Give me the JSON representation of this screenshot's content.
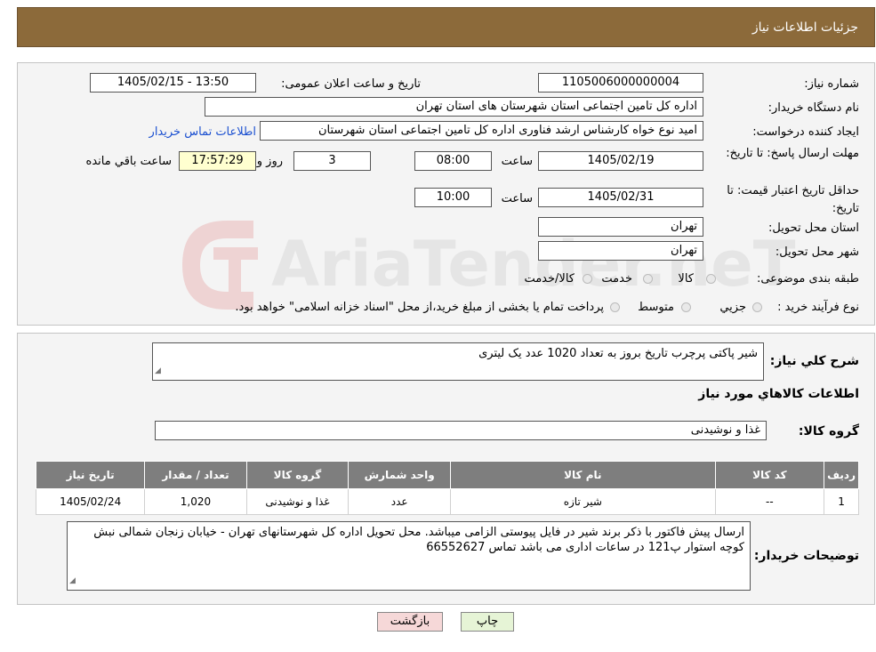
{
  "header": {
    "title": "جزئیات اطلاعات نیاز"
  },
  "form": {
    "need_number_label": "شماره نیاز:",
    "need_number": "1105006000000004",
    "announce_label": "تاریخ و ساعت اعلان عمومی:",
    "announce_value": "1405/02/15 - 13:50",
    "buyer_org_label": "نام دستگاه خریدار:",
    "buyer_org": "اداره کل تامین اجتماعی استان شهرستان های استان تهران",
    "creator_label": "ایجاد کننده درخواست:",
    "creator": "امید نوع خواه کارشناس ارشد فناوری اداره کل تامین اجتماعی استان شهرستان",
    "contact_link": "اطلاعات تماس خریدار",
    "deadline_label": "مهلت ارسال پاسخ: تا تاریخ:",
    "deadline_date": "1405/02/19",
    "time_label": "ساعت",
    "deadline_time": "08:00",
    "days_value": "3",
    "days_label": "روز و",
    "remaining_time": "17:57:29",
    "remaining_label": "ساعت باقي مانده",
    "validity_label": "حداقل تاریخ اعتبار قیمت: تا تاریخ:",
    "validity_date": "1405/02/31",
    "validity_time": "10:00",
    "province_label": "استان محل تحویل:",
    "province": "تهران",
    "city_label": "شهر محل تحویل:",
    "city": "تهران",
    "category_label": "طبقه بندی موضوعی:",
    "category_options": [
      "کالا",
      "خدمت",
      "کالا/خدمت"
    ],
    "process_label": "نوع فرآیند خرید :",
    "process_options": [
      "جزیي",
      "متوسط"
    ],
    "process_note": "پرداخت تمام یا بخشی از مبلغ خرید،از محل \"اسناد خزانه اسلامی\" خواهد بود."
  },
  "details": {
    "summary_label": "شرح کلي نياز:",
    "summary_text": "شیر پاکتی پرچرب تاریخ بروز به تعداد 1020 عدد یک لیتری",
    "goods_info_title": "اطلاعات کالاهاي مورد نياز",
    "goods_group_label": "گروه کالا:",
    "goods_group": "غذا و نوشیدنی",
    "table": {
      "headers": [
        "رديف",
        "کد کالا",
        "نام کالا",
        "واحد شمارش",
        "گروه کالا",
        "تعداد / مقدار",
        "تاریخ نیاز"
      ],
      "rows": [
        [
          "1",
          "--",
          "شیر تازه",
          "عدد",
          "غذا و نوشیدنی",
          "1,020",
          "1405/02/24"
        ]
      ]
    },
    "buyer_notes_label": "توضیحات خریدار:",
    "buyer_notes": "ارسال پیش فاکتور با ذکر برند شیر در فایل پیوستی الزامی میباشد. محل تحویل اداره کل شهرستانهای تهران - خیابان زنجان شمالی نبش کوچه استوار پ121 در ساعات اداری می باشد تماس 66552627"
  },
  "buttons": {
    "print": "چاپ",
    "back": "بازگشت"
  },
  "watermark": {
    "text": "AriaTender.neT"
  },
  "colors": {
    "header_bg": "#8c6a3a",
    "link": "#1a4fd0",
    "back_btn_bg": "#f6d8d8",
    "print_btn_bg": "#e6f4d6"
  }
}
